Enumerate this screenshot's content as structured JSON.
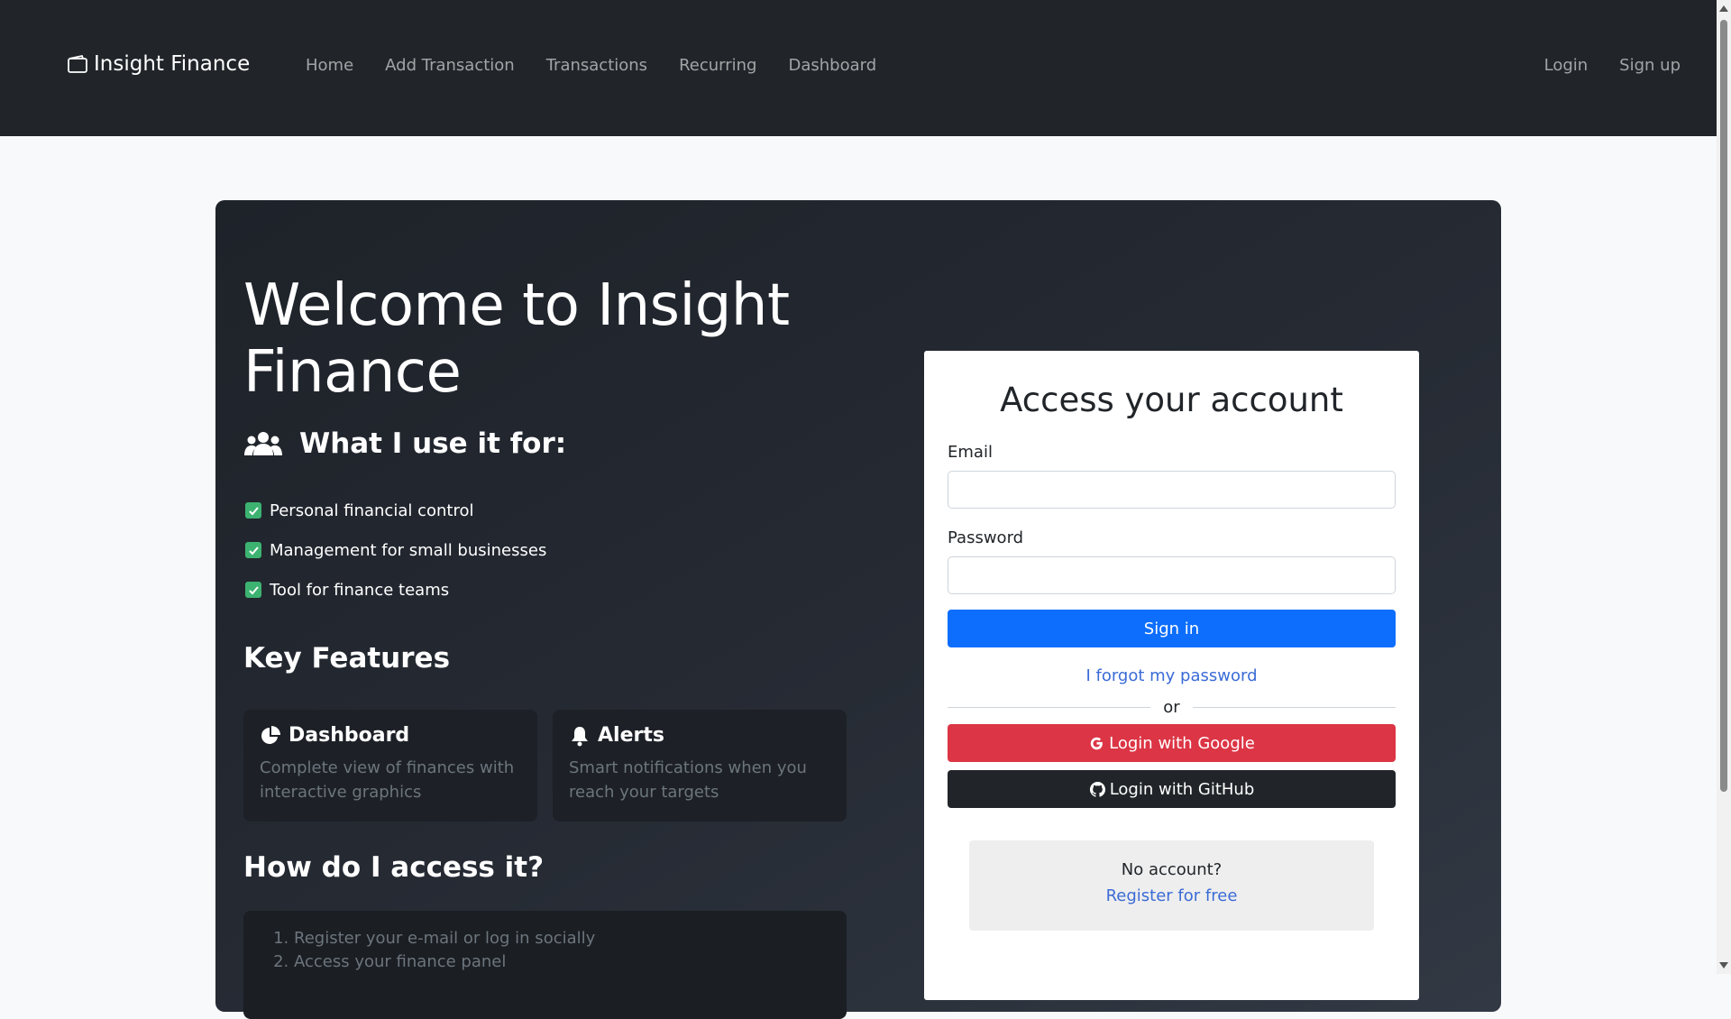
{
  "nav": {
    "brand": "Insight Finance",
    "brand_icon": "wallet-icon",
    "links": [
      "Home",
      "Add Transaction",
      "Transactions",
      "Recurring",
      "Dashboard"
    ],
    "right_links": [
      "Login",
      "Sign up"
    ]
  },
  "hero": {
    "title": "Welcome to Insight Finance",
    "use_heading": "What I use it for:",
    "use_icon": "users-icon",
    "uses": [
      "Personal financial control",
      "Management for small businesses",
      "Tool for finance teams"
    ],
    "features_title": "Key Features",
    "features": [
      {
        "title": "Dashboard",
        "icon": "pie-chart-icon",
        "desc": "Complete view of finances with interactive graphics"
      },
      {
        "title": "Alerts",
        "icon": "bell-icon",
        "desc": "Smart notifications when you reach your targets"
      }
    ],
    "access_title": "How do I access it?",
    "steps": [
      "Register your e-mail or log in socially",
      "Access your finance panel"
    ]
  },
  "login": {
    "title": "Access your account",
    "email_label": "Email",
    "email_value": "",
    "password_label": "Password",
    "password_value": "",
    "signin": "Sign in",
    "forgot": "I forgot my password",
    "divider": "or",
    "google": "Login with Google",
    "github": "Login with GitHub",
    "no_account": "No account?",
    "register": "Register for free"
  },
  "colors": {
    "navbar": "#212529",
    "primary": "#0d6efd",
    "google": "#dc3545",
    "github": "#212529",
    "check": "#3cb371",
    "link": "#3b6bd6"
  }
}
